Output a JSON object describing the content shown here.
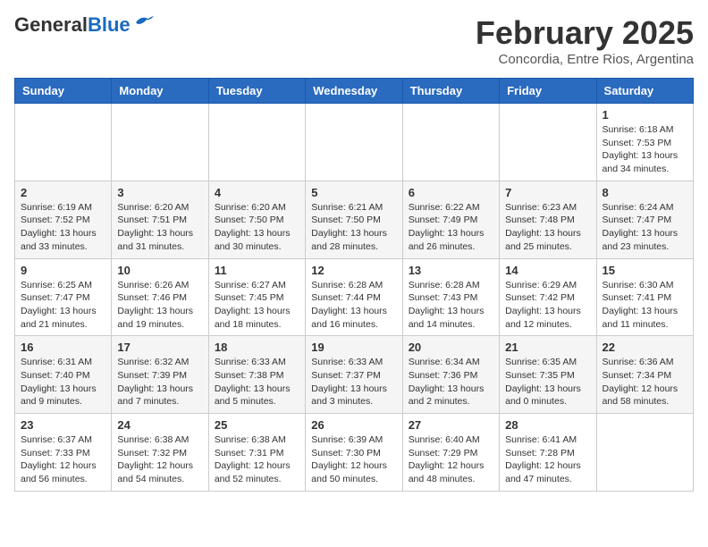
{
  "header": {
    "logo_general": "General",
    "logo_blue": "Blue",
    "month_title": "February 2025",
    "subtitle": "Concordia, Entre Rios, Argentina"
  },
  "weekdays": [
    "Sunday",
    "Monday",
    "Tuesday",
    "Wednesday",
    "Thursday",
    "Friday",
    "Saturday"
  ],
  "weeks": [
    [
      {
        "day": "",
        "info": ""
      },
      {
        "day": "",
        "info": ""
      },
      {
        "day": "",
        "info": ""
      },
      {
        "day": "",
        "info": ""
      },
      {
        "day": "",
        "info": ""
      },
      {
        "day": "",
        "info": ""
      },
      {
        "day": "1",
        "info": "Sunrise: 6:18 AM\nSunset: 7:53 PM\nDaylight: 13 hours\nand 34 minutes."
      }
    ],
    [
      {
        "day": "2",
        "info": "Sunrise: 6:19 AM\nSunset: 7:52 PM\nDaylight: 13 hours\nand 33 minutes."
      },
      {
        "day": "3",
        "info": "Sunrise: 6:20 AM\nSunset: 7:51 PM\nDaylight: 13 hours\nand 31 minutes."
      },
      {
        "day": "4",
        "info": "Sunrise: 6:20 AM\nSunset: 7:50 PM\nDaylight: 13 hours\nand 30 minutes."
      },
      {
        "day": "5",
        "info": "Sunrise: 6:21 AM\nSunset: 7:50 PM\nDaylight: 13 hours\nand 28 minutes."
      },
      {
        "day": "6",
        "info": "Sunrise: 6:22 AM\nSunset: 7:49 PM\nDaylight: 13 hours\nand 26 minutes."
      },
      {
        "day": "7",
        "info": "Sunrise: 6:23 AM\nSunset: 7:48 PM\nDaylight: 13 hours\nand 25 minutes."
      },
      {
        "day": "8",
        "info": "Sunrise: 6:24 AM\nSunset: 7:47 PM\nDaylight: 13 hours\nand 23 minutes."
      }
    ],
    [
      {
        "day": "9",
        "info": "Sunrise: 6:25 AM\nSunset: 7:47 PM\nDaylight: 13 hours\nand 21 minutes."
      },
      {
        "day": "10",
        "info": "Sunrise: 6:26 AM\nSunset: 7:46 PM\nDaylight: 13 hours\nand 19 minutes."
      },
      {
        "day": "11",
        "info": "Sunrise: 6:27 AM\nSunset: 7:45 PM\nDaylight: 13 hours\nand 18 minutes."
      },
      {
        "day": "12",
        "info": "Sunrise: 6:28 AM\nSunset: 7:44 PM\nDaylight: 13 hours\nand 16 minutes."
      },
      {
        "day": "13",
        "info": "Sunrise: 6:28 AM\nSunset: 7:43 PM\nDaylight: 13 hours\nand 14 minutes."
      },
      {
        "day": "14",
        "info": "Sunrise: 6:29 AM\nSunset: 7:42 PM\nDaylight: 13 hours\nand 12 minutes."
      },
      {
        "day": "15",
        "info": "Sunrise: 6:30 AM\nSunset: 7:41 PM\nDaylight: 13 hours\nand 11 minutes."
      }
    ],
    [
      {
        "day": "16",
        "info": "Sunrise: 6:31 AM\nSunset: 7:40 PM\nDaylight: 13 hours\nand 9 minutes."
      },
      {
        "day": "17",
        "info": "Sunrise: 6:32 AM\nSunset: 7:39 PM\nDaylight: 13 hours\nand 7 minutes."
      },
      {
        "day": "18",
        "info": "Sunrise: 6:33 AM\nSunset: 7:38 PM\nDaylight: 13 hours\nand 5 minutes."
      },
      {
        "day": "19",
        "info": "Sunrise: 6:33 AM\nSunset: 7:37 PM\nDaylight: 13 hours\nand 3 minutes."
      },
      {
        "day": "20",
        "info": "Sunrise: 6:34 AM\nSunset: 7:36 PM\nDaylight: 13 hours\nand 2 minutes."
      },
      {
        "day": "21",
        "info": "Sunrise: 6:35 AM\nSunset: 7:35 PM\nDaylight: 13 hours\nand 0 minutes."
      },
      {
        "day": "22",
        "info": "Sunrise: 6:36 AM\nSunset: 7:34 PM\nDaylight: 12 hours\nand 58 minutes."
      }
    ],
    [
      {
        "day": "23",
        "info": "Sunrise: 6:37 AM\nSunset: 7:33 PM\nDaylight: 12 hours\nand 56 minutes."
      },
      {
        "day": "24",
        "info": "Sunrise: 6:38 AM\nSunset: 7:32 PM\nDaylight: 12 hours\nand 54 minutes."
      },
      {
        "day": "25",
        "info": "Sunrise: 6:38 AM\nSunset: 7:31 PM\nDaylight: 12 hours\nand 52 minutes."
      },
      {
        "day": "26",
        "info": "Sunrise: 6:39 AM\nSunset: 7:30 PM\nDaylight: 12 hours\nand 50 minutes."
      },
      {
        "day": "27",
        "info": "Sunrise: 6:40 AM\nSunset: 7:29 PM\nDaylight: 12 hours\nand 48 minutes."
      },
      {
        "day": "28",
        "info": "Sunrise: 6:41 AM\nSunset: 7:28 PM\nDaylight: 12 hours\nand 47 minutes."
      },
      {
        "day": "",
        "info": ""
      }
    ]
  ]
}
